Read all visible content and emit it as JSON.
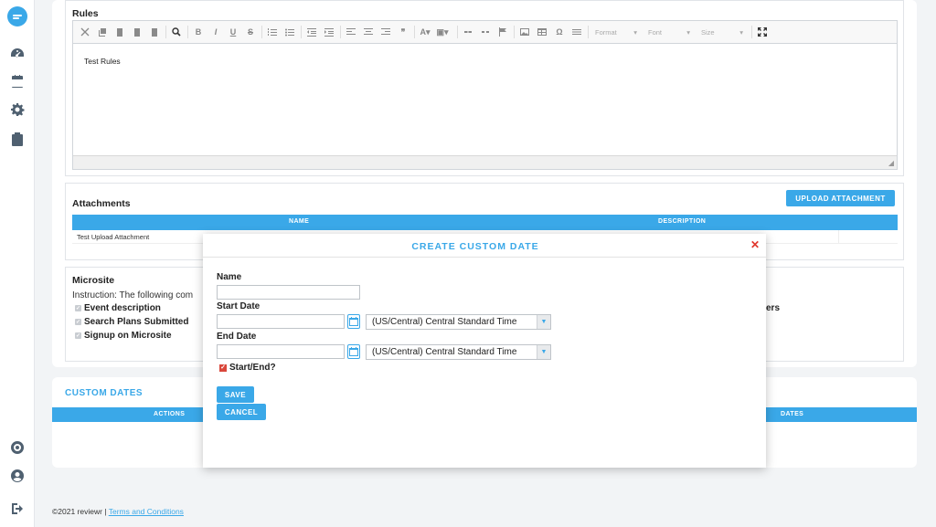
{
  "sidebar": {
    "icons": [
      "dashboard-icon",
      "calendar-icon",
      "gear-icon",
      "clipboard-icon",
      "support-icon",
      "user-icon",
      "logout-icon"
    ]
  },
  "rules": {
    "title": "Rules",
    "content": "Test Rules",
    "toolbar": {
      "format_label": "Format",
      "font_label": "Font",
      "size_label": "Size"
    }
  },
  "attachments": {
    "title": "Attachments",
    "upload_label": "UPLOAD ATTACHMENT",
    "columns": [
      "NAME",
      "DESCRIPTION"
    ],
    "rows": [
      {
        "name": "Test Upload Attachment",
        "description": ""
      }
    ]
  },
  "microsite": {
    "title": "Microsite",
    "instruction": "Instruction: The following com",
    "items": [
      "Event description",
      "Search Plans Submitted",
      "Signup on Microsite"
    ],
    "right_fragment": "ers"
  },
  "custom_dates": {
    "title": "CUSTOM DATES",
    "columns": [
      "ACTIONS",
      "DATES"
    ]
  },
  "modal": {
    "title": "CREATE CUSTOM DATE",
    "name_label": "Name",
    "name_value": "",
    "start_label": "Start Date",
    "start_value": "",
    "start_tz": "(US/Central) Central Standard Time",
    "end_label": "End Date",
    "end_value": "",
    "end_tz": "(US/Central) Central Standard Time",
    "startend_label": "Start/End?",
    "startend_checked": true,
    "save_label": "SAVE",
    "cancel_label": "CANCEL"
  },
  "footer": {
    "copyright": "©2021 reviewr | ",
    "terms_label": "Terms and Conditions"
  },
  "colors": {
    "accent": "#3aa8e8",
    "danger": "#d9473b"
  }
}
